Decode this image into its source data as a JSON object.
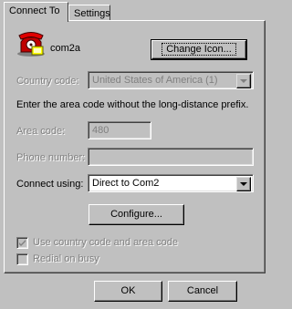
{
  "tabs": [
    {
      "label": "Connect To"
    },
    {
      "label": "Settings"
    }
  ],
  "connection": {
    "icon": "telephone-icon",
    "name": "com2a",
    "change_icon_label": "Change Icon..."
  },
  "country": {
    "label": "Country code:",
    "value": "United States of America (1)"
  },
  "instructions": "Enter the area code without the long-distance prefix.",
  "area_code": {
    "label": "Area code:",
    "value": "480"
  },
  "phone": {
    "label": "Phone number:",
    "value": ""
  },
  "connect_using": {
    "label": "Connect using:",
    "value": "Direct to Com2"
  },
  "configure_label": "Configure...",
  "checkboxes": {
    "use_country_code": {
      "label": "Use country code and area code",
      "checked": true
    },
    "redial": {
      "label": "Redial on busy",
      "checked": false
    }
  },
  "footer": {
    "ok_label": "OK",
    "cancel_label": "Cancel"
  }
}
